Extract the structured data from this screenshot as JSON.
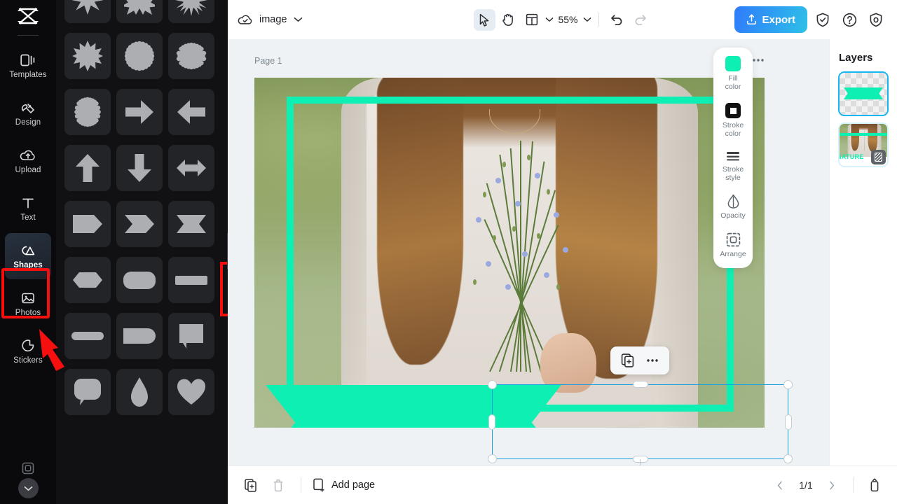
{
  "app": {
    "name": "CapCut",
    "logo_icon": "capcut-logo"
  },
  "colors": {
    "mint_fill": "#0EEFB4",
    "selection_blue": "#1A9FE0",
    "highlight_red": "#F60F0F",
    "export_gradient_from": "#2F7BFB",
    "export_gradient_to": "#2EC0E8",
    "panel_dark": "#111114",
    "rail_dark": "#0A0A0C"
  },
  "sidebar": {
    "items": [
      {
        "label": "Templates",
        "icon": "templates-icon",
        "active": false
      },
      {
        "label": "Design",
        "icon": "design-icon",
        "active": false
      },
      {
        "label": "Upload",
        "icon": "upload-cloud-icon",
        "active": false
      },
      {
        "label": "Text",
        "icon": "text-icon",
        "active": false
      },
      {
        "label": "Shapes",
        "icon": "shapes-icon",
        "active": true
      },
      {
        "label": "Photos",
        "icon": "photos-icon",
        "active": false
      },
      {
        "label": "Stickers",
        "icon": "stickers-icon",
        "active": false
      }
    ],
    "more_icon": "frame-icon",
    "expand_icon": "chevron-down-icon"
  },
  "shapes_panel": {
    "collapse_icon": "chevron-left-icon",
    "selected_index": 14,
    "tiles": [
      {
        "name": "star-8-point"
      },
      {
        "name": "star-10-point"
      },
      {
        "name": "starburst-many-point"
      },
      {
        "name": "star-12-point"
      },
      {
        "name": "seal-scalloped-circle"
      },
      {
        "name": "seal-scalloped-oval-wide"
      },
      {
        "name": "seal-scalloped-oval-tall"
      },
      {
        "name": "arrow-right"
      },
      {
        "name": "arrow-left"
      },
      {
        "name": "arrow-up"
      },
      {
        "name": "arrow-down"
      },
      {
        "name": "arrow-double-horizontal"
      },
      {
        "name": "pentagon-banner-right"
      },
      {
        "name": "chevron-banner-right"
      },
      {
        "name": "ribbon-banner"
      },
      {
        "name": "hexagon-flat"
      },
      {
        "name": "rounded-rectangle-wide"
      },
      {
        "name": "bar-rectangle"
      },
      {
        "name": "bar-rounded-thin"
      },
      {
        "name": "rounded-rect-right"
      },
      {
        "name": "speech-bubble-square"
      },
      {
        "name": "speech-bubble-round"
      },
      {
        "name": "teardrop"
      },
      {
        "name": "heart"
      }
    ]
  },
  "topbar": {
    "cloud_icon": "cloud-check-icon",
    "doc_title": "image",
    "title_chevron_icon": "chevron-down-icon",
    "tools": [
      {
        "name": "select-tool",
        "icon": "cursor-arrow-icon",
        "selected": true
      },
      {
        "name": "hand-tool",
        "icon": "hand-icon",
        "selected": false
      },
      {
        "name": "layout-tool",
        "icon": "layout-grid-icon",
        "selected": false
      }
    ],
    "layout_chevron_icon": "chevron-down-icon",
    "zoom_level": "55%",
    "zoom_chevron_icon": "chevron-down-icon",
    "undo_icon": "undo-icon",
    "redo_icon": "redo-icon",
    "export_label": "Export",
    "export_icon": "upload-icon",
    "right_icons": [
      {
        "name": "shield-check-icon"
      },
      {
        "name": "help-question-icon"
      },
      {
        "name": "settings-shield-icon"
      }
    ]
  },
  "canvas": {
    "page_label": "Page 1",
    "page_tools": [
      {
        "name": "duplicate-page-icon"
      },
      {
        "name": "more-options-icon"
      }
    ],
    "photo_description": "Woman in white sweater holding blue flax flowers in a green field",
    "overlay_frame": {
      "name": "green-rectangle-frame",
      "color": "#0EEFB4",
      "stroke_width": 10
    },
    "selected_shape": {
      "name": "ribbon-banner",
      "fill": "#0EEFB4"
    },
    "context_menu": [
      {
        "name": "duplicate-icon"
      },
      {
        "name": "more-options-icon"
      }
    ],
    "rotate_handle_icon": "rotate-icon"
  },
  "properties": {
    "items": [
      {
        "label_line1": "Fill",
        "label_line2": "color",
        "icon": "fill-color-swatch",
        "value": "#0EEFB4"
      },
      {
        "label_line1": "Stroke",
        "label_line2": "color",
        "icon": "stroke-color-swatch",
        "value": "#111111"
      },
      {
        "label_line1": "Stroke",
        "label_line2": "style",
        "icon": "stroke-style-icon"
      },
      {
        "label_line1": "Opacity",
        "label_line2": "",
        "icon": "opacity-drop-icon"
      },
      {
        "label_line1": "Arrange",
        "label_line2": "",
        "icon": "arrange-icon"
      }
    ]
  },
  "layers": {
    "title": "Layers",
    "items": [
      {
        "name": "ribbon-shape-layer",
        "type": "shape",
        "selected": true
      },
      {
        "name": "photo-layer",
        "type": "image",
        "selected": false,
        "caption": "NATURE",
        "badge_icon": "mask-icon"
      }
    ]
  },
  "bottombar": {
    "duplicate_icon": "duplicate-page-icon",
    "delete_icon": "trash-icon",
    "add_page_label": "Add page",
    "add_page_icon": "add-page-icon",
    "prev_icon": "chevron-left-icon",
    "page_indicator": "1/1",
    "next_icon": "chevron-right-icon",
    "notes_icon": "notes-icon"
  },
  "annotations": {
    "shapes_button_highlight": {
      "color": "#F60F0F",
      "shape": "rectangle-outline"
    },
    "shape_tile_highlight": {
      "color": "#F60F0F",
      "shape": "rectangle-outline"
    },
    "pointer_arrow": {
      "color": "#F60F0F",
      "shape": "arrow-up-left"
    }
  }
}
